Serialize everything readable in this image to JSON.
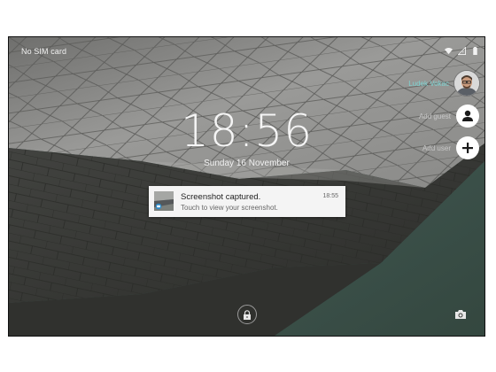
{
  "status_bar": {
    "carrier": "No SIM card",
    "icons": [
      "wifi-icon",
      "signal-icon",
      "battery-icon"
    ]
  },
  "lockscreen": {
    "time_hours": "18",
    "time_minutes": "56",
    "date": "Sunday 16 November"
  },
  "users": {
    "current": {
      "name": "Ludek Vokac",
      "icon": "avatar"
    },
    "guest": {
      "label": "Add guest",
      "icon": "person-icon"
    },
    "add_user": {
      "label": "Add user",
      "icon": "plus-icon"
    }
  },
  "notification": {
    "title": "Screenshot captured.",
    "body": "Touch to view your screenshot.",
    "time": "18:55",
    "icon": "screenshot-thumbnail"
  },
  "bottom": {
    "lock_icon": "lock-icon",
    "camera_icon": "camera-icon"
  },
  "colors": {
    "accent": "#7fd4d2",
    "teal_background": "#3f5754",
    "wall_light": "#8f8f8d",
    "wall_dark": "#3a3b38"
  }
}
